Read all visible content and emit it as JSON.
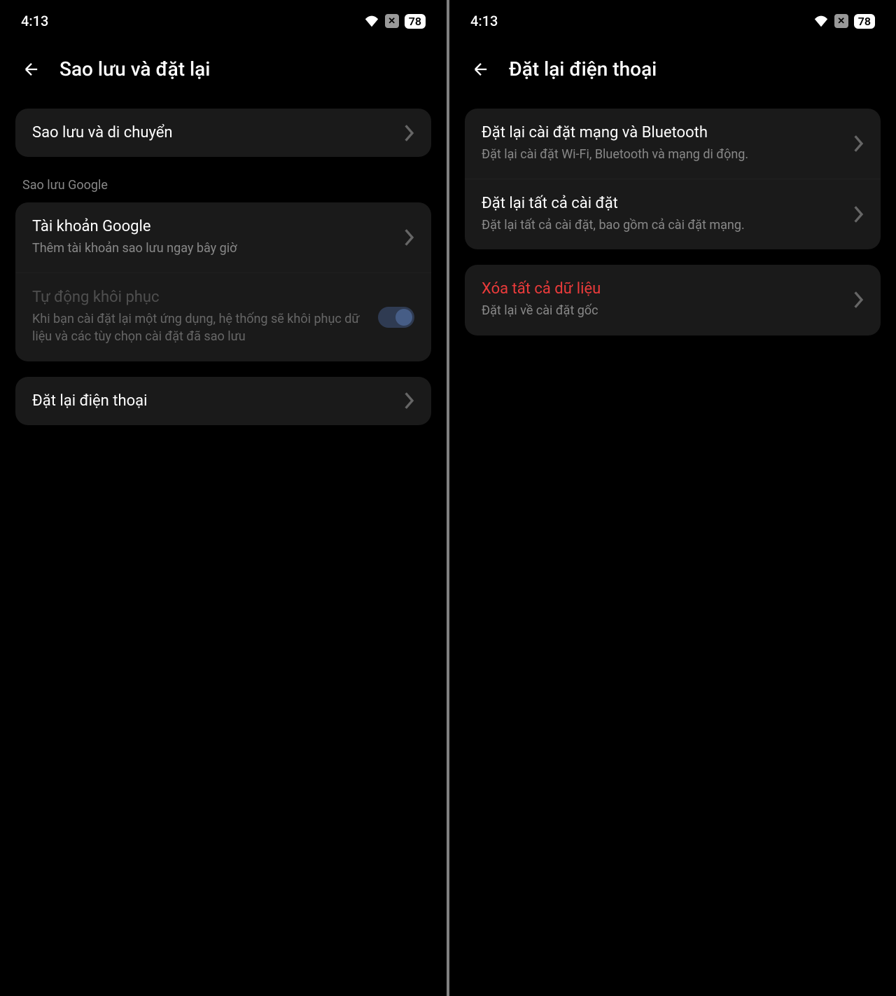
{
  "status": {
    "time": "4:13",
    "battery": "78"
  },
  "left": {
    "title": "Sao lưu và đặt lại",
    "items": {
      "backup_move": {
        "title": "Sao lưu và di chuyển"
      },
      "google_section_label": "Sao lưu Google",
      "google_account": {
        "title": "Tài khoản Google",
        "subtitle": "Thêm tài khoản sao lưu ngay bây giờ"
      },
      "auto_restore": {
        "title": "Tự động khôi phục",
        "subtitle": "Khi bạn cài đặt lại một ứng dụng, hệ thống sẽ khôi phục dữ liệu và các tùy chọn cài đặt đã sao lưu"
      },
      "reset_phone": {
        "title": "Đặt lại điện thoại"
      }
    }
  },
  "right": {
    "title": "Đặt lại điện thoại",
    "items": {
      "reset_network": {
        "title": "Đặt lại cài đặt mạng và Bluetooth",
        "subtitle": "Đặt lại cài đặt Wi-Fi, Bluetooth và mạng di động."
      },
      "reset_all": {
        "title": "Đặt lại tất cả cài đặt",
        "subtitle": "Đặt lại tất cả cài đặt, bao gồm cả cài đặt mạng."
      },
      "erase_all": {
        "title": "Xóa tất cả dữ liệu",
        "subtitle": "Đặt lại về cài đặt gốc"
      }
    }
  }
}
